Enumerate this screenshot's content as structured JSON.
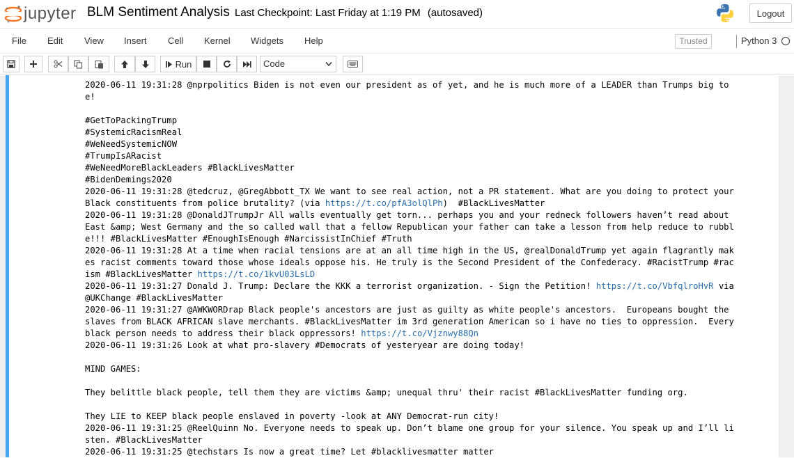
{
  "header": {
    "logo_text": "jupyter",
    "notebook_name": "BLM Sentiment Analysis",
    "checkpoint": "Last Checkpoint: Last Friday at 1:19 PM",
    "autosaved": "(autosaved)",
    "logout_label": "Logout"
  },
  "menubar": {
    "items": [
      "File",
      "Edit",
      "View",
      "Insert",
      "Cell",
      "Kernel",
      "Widgets",
      "Help"
    ],
    "trusted": "Trusted",
    "kernel": "Python 3"
  },
  "toolbar": {
    "run_label": "Run",
    "cell_type": "Code"
  },
  "output": {
    "lines": [
      [
        {
          "t": "2020-06-11 19:31:28 @nprpolitics Biden is not even our president as of yet, and he is much more of a LEADER than Trumps big to"
        }
      ],
      [
        {
          "t": "e!"
        }
      ],
      [
        {
          "t": ""
        }
      ],
      [
        {
          "t": "#GetToPackingTrump"
        }
      ],
      [
        {
          "t": "#SystemicRacismReal"
        }
      ],
      [
        {
          "t": "#WeNeedSystemicNOW"
        }
      ],
      [
        {
          "t": "#TrumpIsARacist"
        }
      ],
      [
        {
          "t": "#WeNeedMoreBlackLeaders #BlackLivesMatter"
        }
      ],
      [
        {
          "t": "#BidenDemings2020"
        }
      ],
      [
        {
          "t": "2020-06-11 19:31:28 @tedcruz, @GregAbbott_TX We want to see real action, not a PR statement. What are you doing to protect your"
        }
      ],
      [
        {
          "t": "Black constituents from police brutality? (via "
        },
        {
          "t": "https://t.co/pfA3olQlPh",
          "link": true
        },
        {
          "t": ")  #BlackLivesMatter"
        }
      ],
      [
        {
          "t": "2020-06-11 19:31:28 @DonaldJTrumpJr All walls eventually get torn... perhaps you and your redneck followers haven’t read about"
        }
      ],
      [
        {
          "t": "East &amp; West Germany and the so called wall that a fellow Republican your father can take a lesson from help reduce to rubbl"
        }
      ],
      [
        {
          "t": "e!!! #BlackLivesMatter #EnoughIsEnough #NarcissistInChief #Truth"
        }
      ],
      [
        {
          "t": "2020-06-11 19:31:28 At a time when racial tensions are at an all time high in the US, @realDonaldTrump yet again flagrantly mak"
        }
      ],
      [
        {
          "t": "es racist comments toward those whose ideals oppose his. He truly is the Second President of the Confederacy. #RacistTrump #rac"
        }
      ],
      [
        {
          "t": "ism #BlackLivesMatter "
        },
        {
          "t": "https://t.co/1kvU03LsLD",
          "link": true
        }
      ],
      [
        {
          "t": "2020-06-11 19:31:27 Donald J. Trump: Declare the KKK a terrorist organization. - Sign the Petition! "
        },
        {
          "t": "https://t.co/VbfqlroHvR",
          "link": true
        },
        {
          "t": " via"
        }
      ],
      [
        {
          "t": "@UKChange #BlackLivesMatter"
        }
      ],
      [
        {
          "t": "2020-06-11 19:31:27 @AWKWORDrap Black people's ancestors are just as guilty as white people's ancestors.  Europeans bought the"
        }
      ],
      [
        {
          "t": "slaves from BLACK AFRICAN slave merchants. #BlackLivesMatter im 3rd generation American so i have no ties to oppression.  Every"
        }
      ],
      [
        {
          "t": "black person needs to address their black oppressors! "
        },
        {
          "t": "https://t.co/Vjznwy88Qn",
          "link": true
        }
      ],
      [
        {
          "t": "2020-06-11 19:31:26 Look at what pro-slavery #Democrats of yesteryear are doing today!"
        }
      ],
      [
        {
          "t": ""
        }
      ],
      [
        {
          "t": "MIND GAMES:"
        }
      ],
      [
        {
          "t": ""
        }
      ],
      [
        {
          "t": "They belittle black people, tell them they are victims &amp; unequal thru' their racist #BlackLivesMatter funding org."
        }
      ],
      [
        {
          "t": ""
        }
      ],
      [
        {
          "t": "They LIE to KEEP black people enslaved in poverty -look at ANY Democrat-run city!"
        }
      ],
      [
        {
          "t": "2020-06-11 19:31:25 @ReelQuinn No. Everyone needs to speak up. Don’t blame one group for your silence. You speak up and I’ll li"
        }
      ],
      [
        {
          "t": "sten. #BlackLivesMatter"
        }
      ],
      [
        {
          "t": "2020-06-11 19:31:25 @techstars Is now a great time? Let #blacklivesmatter matter"
        }
      ]
    ]
  }
}
